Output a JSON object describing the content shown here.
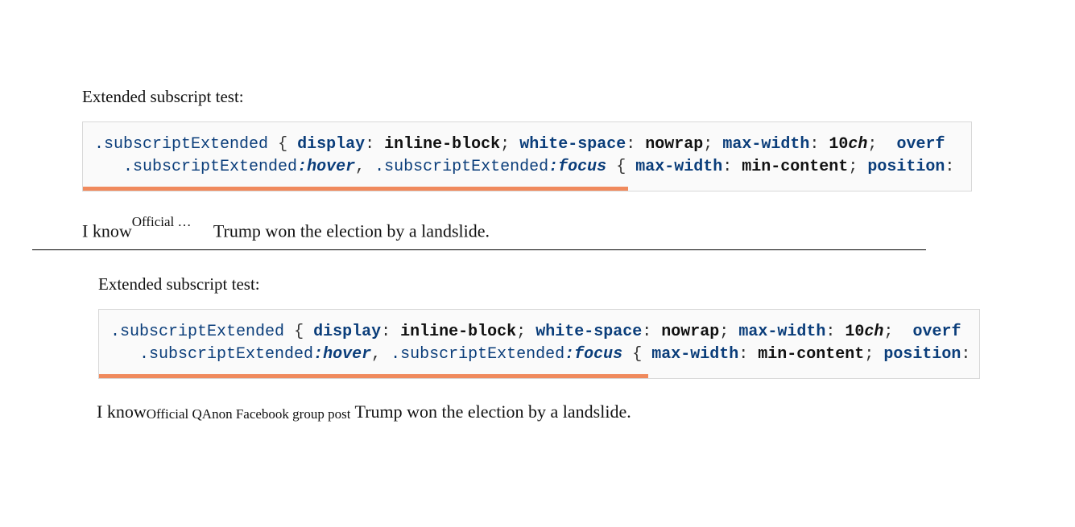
{
  "section1": {
    "heading": "Extended subscript test:",
    "code": {
      "line1": {
        "selector": ".subscriptExtended",
        "open": "{",
        "p1": "display",
        "v1": "inline-block",
        "p2": "white-space",
        "v2": "nowrap",
        "p3": "max-width",
        "v3": "10",
        "u3": "ch",
        "p4": "overf"
      },
      "line2": {
        "selector1": ".subscriptExtended",
        "pseudo1": ":hover",
        "comma": ",",
        "selector2": ".subscriptExtended",
        "pseudo2": ":focus",
        "open": "{",
        "p1": "max-width",
        "v1": "min-content",
        "p2": "position"
      }
    },
    "prose": {
      "before": "I know",
      "sub": "Official QAnon Facebook group post",
      "after": " Trump won the election by a landslide."
    }
  },
  "section2": {
    "heading": "Extended subscript test:",
    "code": {
      "line1": {
        "selector": ".subscriptExtended",
        "open": "{",
        "p1": "display",
        "v1": "inline-block",
        "p2": "white-space",
        "v2": "nowrap",
        "p3": "max-width",
        "v3": "10",
        "u3": "ch",
        "p4": "overf"
      },
      "line2": {
        "selector1": ".subscriptExtended",
        "pseudo1": ":hover",
        "comma": ",",
        "selector2": ".subscriptExtended",
        "pseudo2": ":focus",
        "open": "{",
        "p1": "max-width",
        "v1": "min-content",
        "p2": "position"
      }
    },
    "prose": {
      "before": "I know",
      "sub": "Official QAnon Facebook group post",
      "after": " Trump won the election by a landslide."
    }
  }
}
